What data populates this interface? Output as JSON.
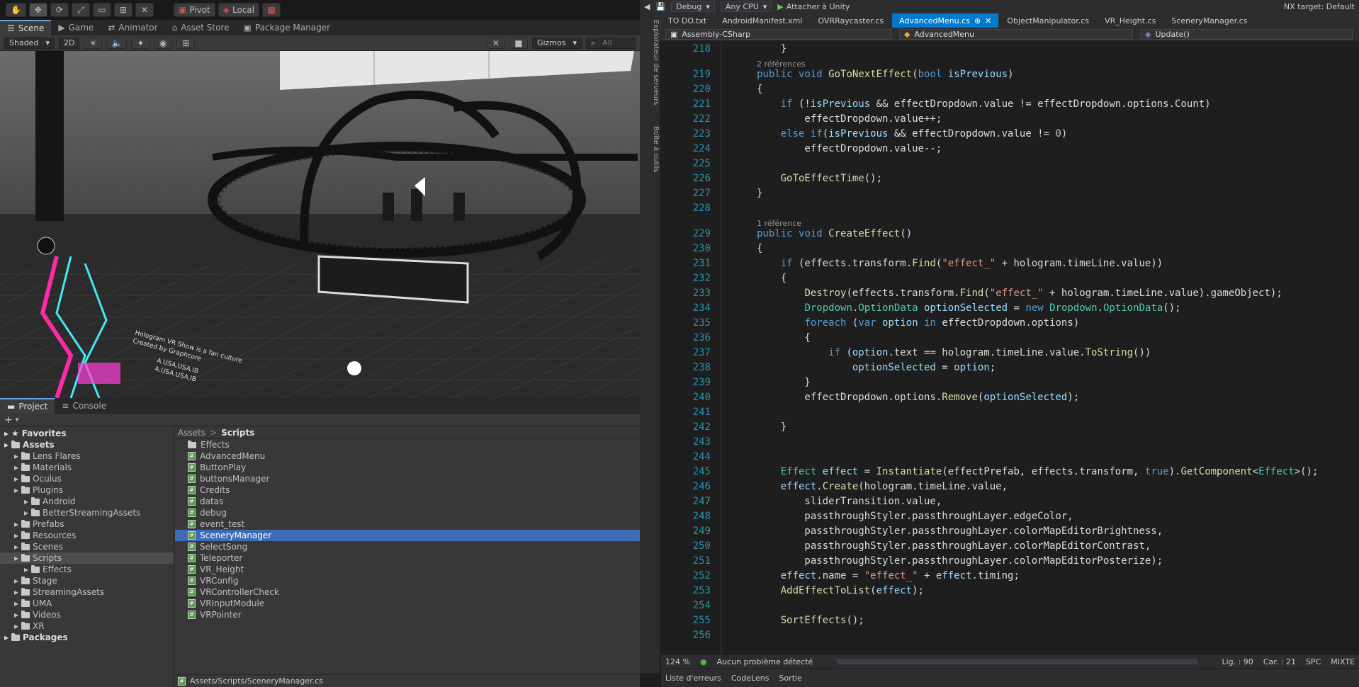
{
  "unity": {
    "toolbar": {
      "pivot": "Pivot",
      "local": "Local"
    },
    "top_tabs": [
      {
        "label": "Scene",
        "icon": "scene-icon"
      },
      {
        "label": "Game",
        "icon": "game-icon"
      },
      {
        "label": "Animator",
        "icon": "animator-icon"
      },
      {
        "label": "Asset Store",
        "icon": "store-icon"
      },
      {
        "label": "Package Manager",
        "icon": "package-icon"
      }
    ],
    "scene_bar": {
      "shading_mode": "Shaded",
      "mode_2d": "2D",
      "gizmos": "Gizmos",
      "search_placeholder": "All"
    },
    "scene_texts": {
      "sign1": "Hologram VR Show is a fan culture",
      "sign2": "Created by Graphcore",
      "sign3": "A.USA.USA.IB",
      "sign4": "A.USA.USA.IB"
    },
    "bottom_tabs": [
      {
        "label": "Project",
        "icon": "folder-icon"
      },
      {
        "label": "Console",
        "icon": "console-icon"
      }
    ],
    "tree": [
      {
        "label": "Favorites",
        "indent": 0,
        "bold": true,
        "icon": "star-icon"
      },
      {
        "label": "Assets",
        "indent": 0,
        "bold": true,
        "icon": "folder-icon"
      },
      {
        "label": "Lens Flares",
        "indent": 1
      },
      {
        "label": "Materials",
        "indent": 1
      },
      {
        "label": "Oculus",
        "indent": 1
      },
      {
        "label": "Plugins",
        "indent": 1
      },
      {
        "label": "Android",
        "indent": 2
      },
      {
        "label": "BetterStreamingAssets",
        "indent": 2
      },
      {
        "label": "Prefabs",
        "indent": 1
      },
      {
        "label": "Resources",
        "indent": 1
      },
      {
        "label": "Scenes",
        "indent": 1
      },
      {
        "label": "Scripts",
        "indent": 1,
        "selected": true
      },
      {
        "label": "Effects",
        "indent": 2
      },
      {
        "label": "Stage",
        "indent": 1
      },
      {
        "label": "StreamingAssets",
        "indent": 1
      },
      {
        "label": "UMA",
        "indent": 1
      },
      {
        "label": "Videos",
        "indent": 1
      },
      {
        "label": "XR",
        "indent": 1
      },
      {
        "label": "Packages",
        "indent": 0,
        "bold": true
      }
    ],
    "breadcrumb": {
      "root": "Assets",
      "sep": ">",
      "current": "Scripts"
    },
    "files": [
      {
        "label": "Effects",
        "folder": true
      },
      {
        "label": "AdvancedMenu"
      },
      {
        "label": "ButtonPlay"
      },
      {
        "label": "buttonsManager"
      },
      {
        "label": "Credits"
      },
      {
        "label": "datas"
      },
      {
        "label": "debug"
      },
      {
        "label": "event_test"
      },
      {
        "label": "SceneryManager",
        "selected": true
      },
      {
        "label": "SelectSong"
      },
      {
        "label": "Teleporter"
      },
      {
        "label": "VR_Height"
      },
      {
        "label": "VRConfig"
      },
      {
        "label": "VRControllerCheck"
      },
      {
        "label": "VRInputModule"
      },
      {
        "label": "VRPointer"
      }
    ],
    "path_status": "Assets/Scripts/SceneryManager.cs"
  },
  "vs": {
    "top": {
      "config": "Debug",
      "platform": "Any CPU",
      "attach": "Attacher à Unity",
      "target": "NX target: Default"
    },
    "tabs": [
      {
        "label": "TO DO.txt"
      },
      {
        "label": "AndroidManifest.xml"
      },
      {
        "label": "OVRRaycaster.cs"
      },
      {
        "label": "AdvancedMenu.cs",
        "active": true
      },
      {
        "label": "ObjectManipulator.cs"
      },
      {
        "label": "VR_Height.cs"
      },
      {
        "label": "SceneryManager.cs"
      }
    ],
    "nav": {
      "project": "Assembly-CSharp",
      "class": "AdvancedMenu",
      "member": "Update()"
    },
    "side_tabs": [
      "Explorateur de serveurs",
      "Boîte à outils"
    ],
    "lines": [
      {
        "n": "218",
        "html": "    }"
      },
      {
        "ref": "2 références"
      },
      {
        "n": "219",
        "html": "<span class='kw'>public</span> <span class='kw'>void</span> <span class='me'>GoToNextEffect</span>(<span class='kw'>bool</span> <span class='pa'>isPrevious</span>)"
      },
      {
        "n": "220",
        "html": "{"
      },
      {
        "n": "221",
        "html": "    <span class='kw'>if</span> (!<span class='pa'>isPrevious</span> &amp;&amp; effectDropdown.value != effectDropdown.options.Count)"
      },
      {
        "n": "222",
        "html": "        effectDropdown.value++;"
      },
      {
        "n": "223",
        "html": "    <span class='kw'>else if</span>(<span class='pa'>isPrevious</span> &amp;&amp; effectDropdown.value != <span class='nu'>0</span>)"
      },
      {
        "n": "224",
        "html": "        effectDropdown.value--;"
      },
      {
        "n": "225",
        "html": ""
      },
      {
        "n": "226",
        "html": "    <span class='me'>GoToEffectTime</span>();"
      },
      {
        "n": "227",
        "html": "}"
      },
      {
        "n": "228",
        "html": ""
      },
      {
        "ref": "1 référence"
      },
      {
        "n": "229",
        "html": "<span class='kw'>public</span> <span class='kw'>void</span> <span class='me'>CreateEffect</span>()"
      },
      {
        "n": "230",
        "html": "{"
      },
      {
        "n": "231",
        "html": "    <span class='kw'>if</span> (effects.transform.<span class='me'>Find</span>(<span class='st'>\"effect_\"</span> + hologram.timeLine.value))"
      },
      {
        "n": "232",
        "html": "    {"
      },
      {
        "n": "233",
        "html": "        <span class='me'>Destroy</span>(effects.transform.<span class='me'>Find</span>(<span class='st'>\"effect_\"</span> + hologram.timeLine.value).gameObject);"
      },
      {
        "n": "234",
        "html": "        <span class='ty'>Dropdown</span>.<span class='ty'>OptionData</span> <span class='pa'>optionSelected</span> = <span class='kw'>new</span> <span class='ty'>Dropdown</span>.<span class='ty'>OptionData</span>();"
      },
      {
        "n": "235",
        "html": "        <span class='kw'>foreach</span> (<span class='kw'>var</span> <span class='pa'>option</span> <span class='kw'>in</span> effectDropdown.options)"
      },
      {
        "n": "236",
        "html": "        {"
      },
      {
        "n": "237",
        "html": "            <span class='kw'>if</span> (<span class='pa'>option</span>.text == hologram.timeLine.value.<span class='me'>ToString</span>())"
      },
      {
        "n": "238",
        "html": "                <span class='pa'>optionSelected</span> = <span class='pa'>option</span>;"
      },
      {
        "n": "239",
        "html": "        }"
      },
      {
        "n": "240",
        "html": "        effectDropdown.options.<span class='me'>Remove</span>(<span class='pa'>optionSelected</span>);"
      },
      {
        "n": "241",
        "html": ""
      },
      {
        "n": "242",
        "html": "    }"
      },
      {
        "n": "243",
        "html": ""
      },
      {
        "n": "244",
        "html": ""
      },
      {
        "n": "245",
        "html": "    <span class='ty'>Effect</span> <span class='pa'>effect</span> = <span class='me'>Instantiate</span>(effectPrefab, effects.transform, <span class='kw'>true</span>).<span class='me'>GetComponent</span>&lt;<span class='ty'>Effect</span>&gt;();"
      },
      {
        "n": "246",
        "html": "    <span class='pa'>effect</span>.<span class='me'>Create</span>(hologram.timeLine.value,"
      },
      {
        "n": "247",
        "html": "        sliderTransition.value,"
      },
      {
        "n": "248",
        "html": "        passthroughStyler.passthroughLayer.edgeColor,"
      },
      {
        "n": "249",
        "html": "        passthroughStyler.passthroughLayer.colorMapEditorBrightness,"
      },
      {
        "n": "250",
        "html": "        passthroughStyler.passthroughLayer.colorMapEditorContrast,"
      },
      {
        "n": "251",
        "html": "        passthroughStyler.passthroughLayer.colorMapEditorPosterize);"
      },
      {
        "n": "252",
        "html": "    <span class='pa'>effect</span>.name = <span class='st'>\"effect_\"</span> + <span class='pa'>effect</span>.timing;"
      },
      {
        "n": "253",
        "html": "    <span class='me'>AddEffectToList</span>(<span class='pa'>effect</span>);"
      },
      {
        "n": "254",
        "html": ""
      },
      {
        "n": "255",
        "html": "    <span class='me'>SortEffects</span>();"
      },
      {
        "n": "256",
        "html": ""
      }
    ],
    "status": {
      "zoom": "124 %",
      "problems": "Aucun problème détecté",
      "line": "Lig. : 90",
      "col": "Car. : 21",
      "spc": "SPC",
      "eol": "MIXTE"
    },
    "bottom_tabs": [
      "Liste d'erreurs",
      "CodeLens",
      "Sortie"
    ]
  }
}
